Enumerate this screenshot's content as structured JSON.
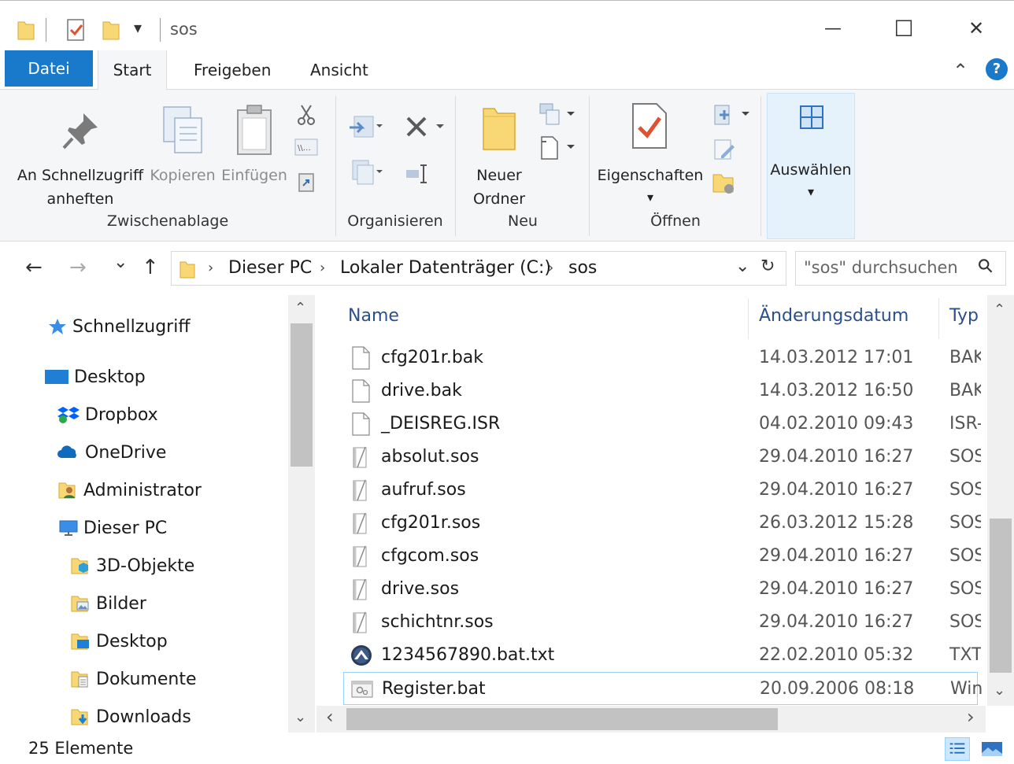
{
  "window": {
    "title": "sos",
    "minimize_label": "—",
    "maximize_label": "☐",
    "close_label": "✕"
  },
  "quick_access_toolbar": {
    "dropdown_glyph": "▾"
  },
  "ribbon_tabs": [
    {
      "label": "Datei"
    },
    {
      "label": "Start"
    },
    {
      "label": "Freigeben"
    },
    {
      "label": "Ansicht"
    }
  ],
  "ribbon": {
    "collapse_glyph": "⌃",
    "help_glyph": "?",
    "pin_line1": "An Schnellzugriff",
    "pin_line2": "anheften",
    "copy_label": "Kopieren",
    "paste_label": "Einfügen",
    "new_folder_line1": "Neuer",
    "new_folder_line2": "Ordner",
    "properties_label": "Eigenschaften",
    "select_label": "Auswählen",
    "dropdown_glyph": "▾",
    "groups": {
      "clipboard": "Zwischenablage",
      "organize": "Organisieren",
      "new": "Neu",
      "open": "Öffnen"
    }
  },
  "address_bar": {
    "back_glyph": "←",
    "forward_glyph": "→",
    "recent_glyph": "⌄",
    "up_glyph": "↑",
    "crumb_sep": "›",
    "crumbs": [
      "Dieser PC",
      "Lokaler Datenträger (C:)",
      "sos"
    ],
    "dropdown_glyph": "⌄",
    "refresh_glyph": "↻",
    "search_placeholder": "\"sos\" durchsuchen",
    "search_glyph": "⚲"
  },
  "nav_pane": {
    "items": [
      {
        "label": "Schnellzugriff",
        "icon": "star-icon"
      },
      {
        "label": "Desktop",
        "icon": "desktop-icon"
      },
      {
        "label": "Dropbox",
        "icon": "dropbox-icon"
      },
      {
        "label": "OneDrive",
        "icon": "onedrive-icon"
      },
      {
        "label": "Administrator",
        "icon": "user-folder-icon"
      },
      {
        "label": "Dieser PC",
        "icon": "pc-icon"
      },
      {
        "label": "3D-Objekte",
        "icon": "3d-objects-icon"
      },
      {
        "label": "Bilder",
        "icon": "pictures-icon"
      },
      {
        "label": "Desktop",
        "icon": "desktop-folder-icon"
      },
      {
        "label": "Dokumente",
        "icon": "documents-icon"
      },
      {
        "label": "Downloads",
        "icon": "downloads-icon"
      }
    ],
    "scroll_up_glyph": "⌃",
    "scroll_down_glyph": "⌄"
  },
  "file_list": {
    "columns": {
      "name": "Name",
      "date": "Änderungsdatum",
      "type": "Typ"
    },
    "files": [
      {
        "name": "cfg201r.bak",
        "date": "14.03.2012 17:01",
        "type": "BAK-",
        "icon": "blank-file-icon"
      },
      {
        "name": "drive.bak",
        "date": "14.03.2012 16:50",
        "type": "BAK-",
        "icon": "blank-file-icon"
      },
      {
        "name": "_DEISREG.ISR",
        "date": "04.02.2010 09:43",
        "type": "ISR-D",
        "icon": "blank-file-icon"
      },
      {
        "name": "absolut.sos",
        "date": "29.04.2010 16:27",
        "type": "SOS-",
        "icon": "notepad-file-icon"
      },
      {
        "name": "aufruf.sos",
        "date": "29.04.2010 16:27",
        "type": "SOS-",
        "icon": "notepad-file-icon"
      },
      {
        "name": "cfg201r.sos",
        "date": "26.03.2012 15:28",
        "type": "SOS-",
        "icon": "notepad-file-icon"
      },
      {
        "name": "cfgcom.sos",
        "date": "29.04.2010 16:27",
        "type": "SOS-",
        "icon": "notepad-file-icon"
      },
      {
        "name": "drive.sos",
        "date": "29.04.2010 16:27",
        "type": "SOS-",
        "icon": "notepad-file-icon"
      },
      {
        "name": "schichtnr.sos",
        "date": "29.04.2010 16:27",
        "type": "SOS-",
        "icon": "notepad-file-icon"
      },
      {
        "name": "1234567890.bat.txt",
        "date": "22.02.2010 05:32",
        "type": "TXT-",
        "icon": "app-file-icon"
      },
      {
        "name": "Register.bat",
        "date": "20.09.2006 08:18",
        "type": "Wind",
        "icon": "batch-file-icon"
      }
    ],
    "scroll_up_glyph": "⌃",
    "scroll_down_glyph": "⌄",
    "scroll_left_glyph": "‹",
    "scroll_right_glyph": "›"
  },
  "status_bar": {
    "item_count": "25 Elemente"
  },
  "colors": {
    "accent": "#1979ca",
    "folder": "#f8d775",
    "check_red": "#e0512f",
    "selection_border": "#99d1ff"
  }
}
